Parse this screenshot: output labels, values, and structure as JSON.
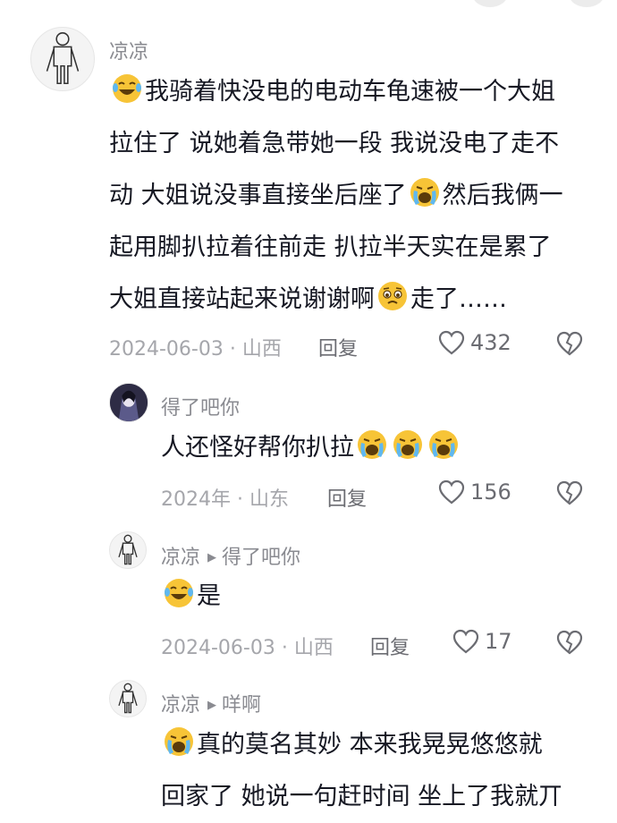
{
  "comments": [
    {
      "username": "凉凉",
      "lines": [
        "我骑着快没电的电动车龟速被一个大姐",
        "拉住了 说她着急带她一段 我说没电了走不",
        "动 大姐说没事直接坐后座了",
        "然后我俩一",
        "起用脚扒拉着往前走 扒拉半天实在是累了",
        "大姐直接站起来说谢谢啊",
        "走了……"
      ],
      "meta": "2024-06-03 · 山西",
      "reply": "回复",
      "likes": "432"
    },
    {
      "username": "得了吧你",
      "lines": [
        "人还怪好帮你扒拉"
      ],
      "meta": "2024年 · 山东",
      "reply": "回复",
      "likes": "156"
    },
    {
      "username": "凉凉",
      "reply_to": "得了吧你",
      "lines": [
        "是"
      ],
      "meta": "2024-06-03 · 山西",
      "reply": "回复",
      "likes": "17"
    },
    {
      "username": "凉凉",
      "reply_to": "咩啊",
      "lines": [
        "真的莫名其妙 本来我晃晃悠悠就",
        "回家了 她说一句赶时间 坐上了我就丌"
      ],
      "meta": "",
      "reply": "",
      "likes": ""
    }
  ],
  "icons": {
    "like": "heart-outline-icon",
    "dislike": "broken-heart-icon",
    "reply_arrow": "triangle-right-icon",
    "emoji_laugh": "laughing-tears-emoji",
    "emoji_cry": "crying-emoji",
    "emoji_plead": "pleading-emoji"
  },
  "colors": {
    "meta": "#a5a6ab",
    "username": "#8a8b91",
    "text": "#161823",
    "emoji": "#f7c437"
  }
}
